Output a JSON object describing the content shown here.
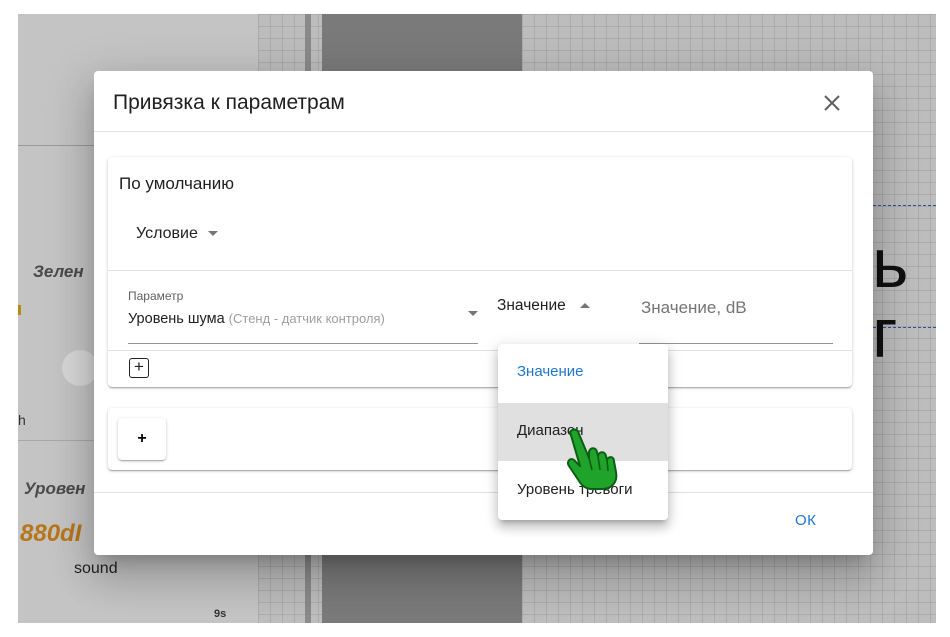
{
  "background": {
    "label_green": "Зелен",
    "label_level": "Уровен",
    "value": "880dI",
    "sound_label": "sound",
    "time_tick": "9s",
    "left_fragment": "h",
    "big_text": "ь г"
  },
  "dialog": {
    "title": "Привязка к параметрам",
    "close_icon": "close-icon",
    "default_card": {
      "title": "По умолчанию",
      "condition_label": "Условие",
      "param_label": "Параметр",
      "param_value": "Уровень шума",
      "param_hint": "(Стенд - датчик контроля)",
      "mode_value": "Значение",
      "value_placeholder": "Значение, dB",
      "add_row_label": "+"
    },
    "add_condition_label": "+",
    "ok_label": "ОК"
  },
  "menu": {
    "items": [
      {
        "label": "Значение",
        "selected": true
      },
      {
        "label": "Диапазон",
        "hovered": true
      },
      {
        "label": "Уровень тревоги"
      }
    ]
  },
  "colors": {
    "accent": "#1e76d2",
    "cursor_green": "#1fa32b",
    "bg_value_orange": "#b8761a"
  }
}
